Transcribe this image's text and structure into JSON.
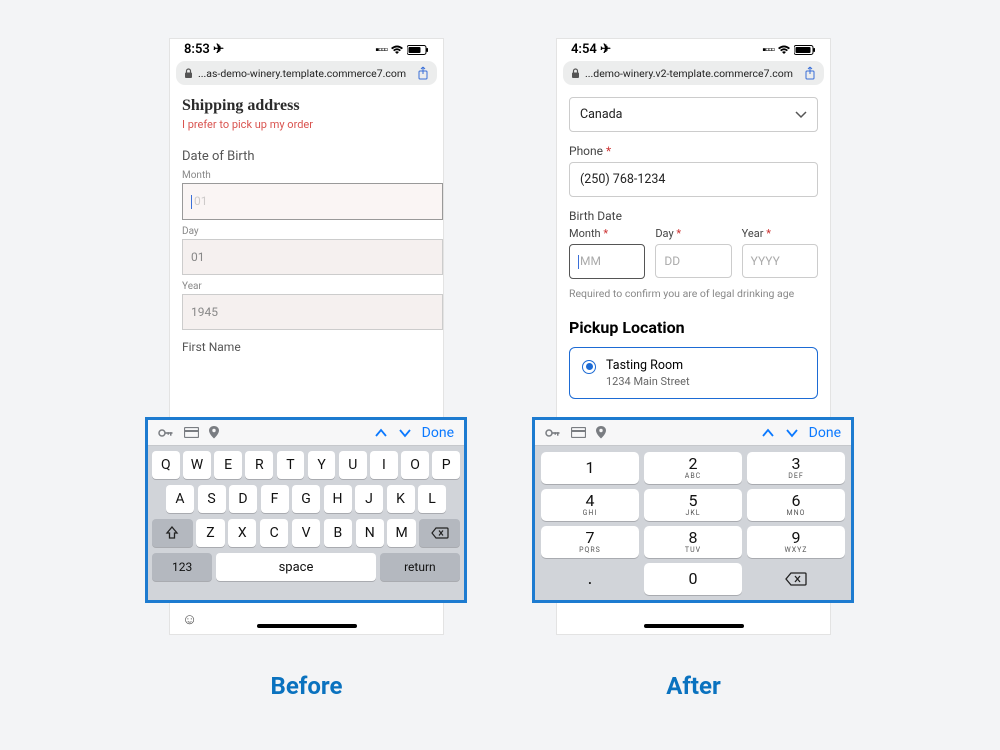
{
  "captions": {
    "before": "Before",
    "after": "After"
  },
  "left": {
    "status_time": "8:53",
    "status_nav": "✈",
    "url": "...as-demo-winery.template.commerce7.com",
    "heading": "Shipping address",
    "prefer_text": "I prefer to pick up my order",
    "dob_label": "Date of Birth",
    "fields": {
      "month_label": "Month",
      "month_ph": "01",
      "day_label": "Day",
      "day_ph": "01",
      "year_label": "Year",
      "year_ph": "1945",
      "first_name_label": "First Name"
    },
    "keyboard": {
      "done": "Done",
      "rows": [
        [
          "Q",
          "W",
          "E",
          "R",
          "T",
          "Y",
          "U",
          "I",
          "O",
          "P"
        ],
        [
          "A",
          "S",
          "D",
          "F",
          "G",
          "H",
          "J",
          "K",
          "L"
        ],
        [
          "Z",
          "X",
          "C",
          "V",
          "B",
          "N",
          "M"
        ]
      ],
      "num_key": "123",
      "space_key": "space",
      "return_key": "return"
    }
  },
  "right": {
    "status_time": "4:54",
    "status_nav": "✈",
    "url": "...demo-winery.v2-template.commerce7.com",
    "country_value": "Canada",
    "phone_label": "Phone",
    "phone_value": "(250) 768-1234",
    "birth_label": "Birth Date",
    "month_label": "Month",
    "month_ph": "MM",
    "day_label": "Day",
    "day_ph": "DD",
    "year_label": "Year",
    "year_ph": "YYYY",
    "helper": "Required to confirm you are of legal drinking age",
    "pickup_heading": "Pickup Location",
    "pickup_name": "Tasting Room",
    "pickup_addr": "1234 Main Street",
    "keyboard": {
      "done": "Done",
      "keys": [
        {
          "n": "1",
          "s": ""
        },
        {
          "n": "2",
          "s": "ABC"
        },
        {
          "n": "3",
          "s": "DEF"
        },
        {
          "n": "4",
          "s": "GHI"
        },
        {
          "n": "5",
          "s": "JKL"
        },
        {
          "n": "6",
          "s": "MNO"
        },
        {
          "n": "7",
          "s": "PQRS"
        },
        {
          "n": "8",
          "s": "TUV"
        },
        {
          "n": "9",
          "s": "WXYZ"
        }
      ],
      "dot": ".",
      "zero": "0"
    }
  }
}
